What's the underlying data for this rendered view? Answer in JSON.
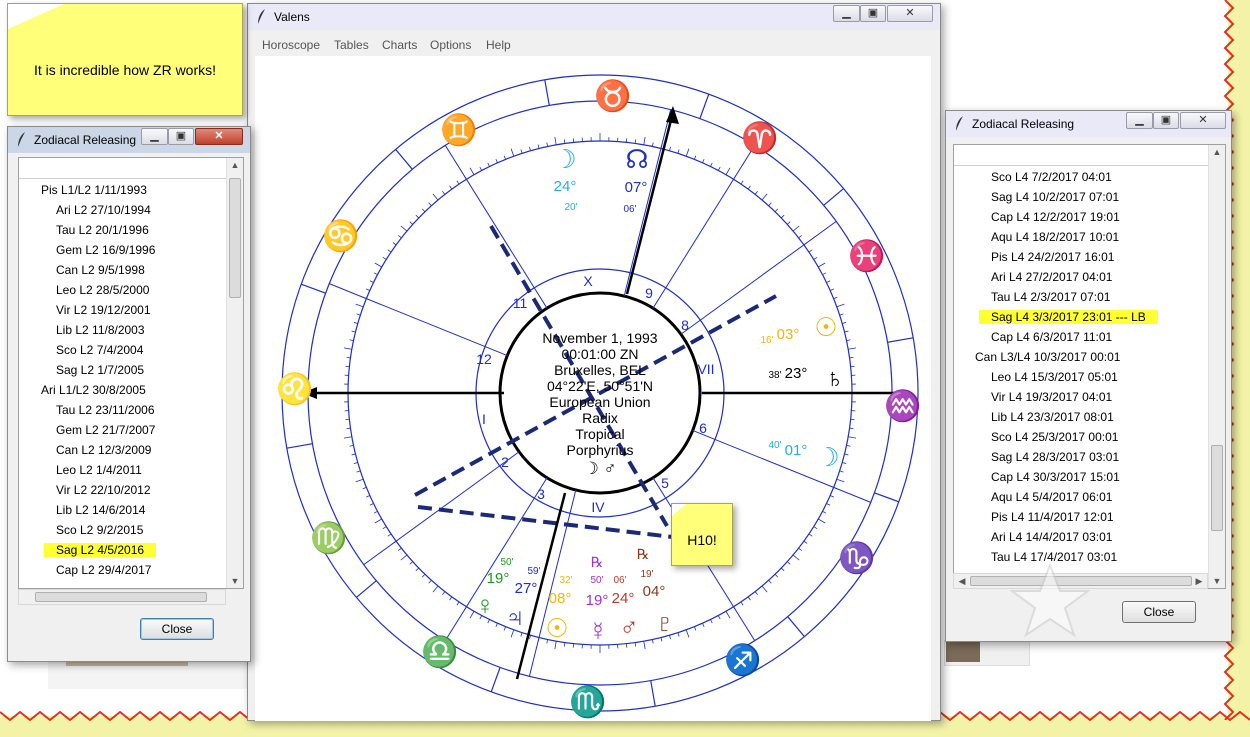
{
  "sticky_note_1": {
    "text": "It is incredible how ZR works!"
  },
  "sticky_note_2": {
    "text": "H10!"
  },
  "main_window": {
    "title": "Valens",
    "menu": [
      "Horoscope",
      "Tables",
      "Charts",
      "Options",
      "Help"
    ],
    "chart": {
      "center_lines": [
        "November 1, 1993",
        "00:01:00 ZN",
        "Bruxelles, BEL",
        "04°22'E, 50°51'N",
        "European Union",
        "Radix",
        "Tropical",
        "Porphyrius"
      ],
      "center_symbols": "☽  ♂",
      "sign_glyphs": [
        "♉",
        "♈",
        "♓",
        "♒",
        "♑",
        "♐",
        "♏",
        "♎",
        "♍",
        "♌",
        "♋",
        "♊"
      ],
      "house_numbers": [
        "X",
        "9",
        "8",
        "VII",
        "6",
        "5",
        "IV",
        "3",
        "2",
        "I",
        "12",
        "11"
      ],
      "planets": {
        "moon": {
          "symbol": "☽",
          "deg": "24°",
          "min": "20'",
          "color": "#1eaee8"
        },
        "node": {
          "symbol": "☊",
          "deg": "07°",
          "min": "06'",
          "color": "#1d2ecb"
        },
        "sun_top": {
          "symbol": "☉",
          "deg": "03°",
          "min": "16'",
          "color": "#f2b600"
        },
        "saturn": {
          "symbol": "♄",
          "deg": "23°",
          "min": "38'",
          "color": "#000000"
        },
        "moon2": {
          "symbol": "☽",
          "deg": "01°",
          "min": "40'",
          "color": "#1eaee8"
        },
        "venus": {
          "symbol": "♀",
          "deg": "19°",
          "min": "50'",
          "color": "#1a9a1a"
        },
        "jupiter": {
          "symbol": "♃",
          "deg": "27°",
          "min": "59'",
          "color": "#1d2ecb"
        },
        "sun": {
          "symbol": "☉",
          "deg": "08°",
          "min": "32'",
          "color": "#f2b600"
        },
        "mercury": {
          "symbol": "☿",
          "deg": "19°",
          "min": "50'",
          "retro": "℞",
          "color": "#a030d0"
        },
        "mars": {
          "symbol": "♂",
          "deg": "24°",
          "min": "06'",
          "color": "#c0392b"
        },
        "pluto": {
          "symbol": "♇",
          "deg": "04°",
          "min": "19'",
          "retro": "℞",
          "color": "#8b3a1a"
        }
      }
    }
  },
  "left_window": {
    "title": "Zodiacal Releasing",
    "items": [
      "Pis L1/L2 1/11/1993",
      "Ari L2 27/10/1994",
      "Tau L2 20/1/1996",
      "Gem L2 16/9/1996",
      "Can L2 9/5/1998",
      "Leo L2 28/5/2000",
      "Vir L2 19/12/2001",
      "Lib L2 11/8/2003",
      "Sco L2 7/4/2004",
      "Sag L2 1/7/2005",
      "Ari L1/L2 30/8/2005",
      "Tau L2 23/11/2006",
      "Gem L2 21/7/2007",
      "Can L2 12/3/2009",
      "Leo L2 1/4/2011",
      "Vir L2 22/10/2012",
      "Lib L2 14/6/2014",
      "Sco L2 9/2/2015",
      "Sag L2 4/5/2016",
      "Cap L2 29/4/2017"
    ],
    "highlight_index": 18,
    "close_label": "Close"
  },
  "right_window": {
    "title": "Zodiacal Releasing",
    "items": [
      "Sco L4 7/2/2017 04:01",
      "Sag L4 10/2/2017 07:01",
      "Cap L4 12/2/2017 19:01",
      "Aqu L4 18/2/2017 10:01",
      "Pis L4 24/2/2017 16:01",
      "Ari L4 27/2/2017 04:01",
      "Tau L4 2/3/2017 07:01",
      "Sag L4 3/3/2017 23:01 --- LB",
      "Cap L4 6/3/2017 11:01",
      "Can L3/L4 10/3/2017 00:01",
      "Leo L4 15/3/2017 05:01",
      "Vir L4 19/3/2017 04:01",
      "Lib L4 23/3/2017 08:01",
      "Sco L4 25/3/2017 00:01",
      "Sag L4 28/3/2017 03:01",
      "Cap L4 30/3/2017 15:01",
      "Aqu L4 5/4/2017 06:01",
      "Pis L4 11/4/2017 12:01",
      "Ari L4 14/4/2017 03:01",
      "Tau L4 17/4/2017 03:01"
    ],
    "highlight_index": 7,
    "close_label": "Close"
  },
  "colors": {
    "accent_blue": "#1d2ecb",
    "highlight": "#ffff33",
    "note_yellow": "#ffff7a",
    "dash_navy": "#1b2a78"
  }
}
